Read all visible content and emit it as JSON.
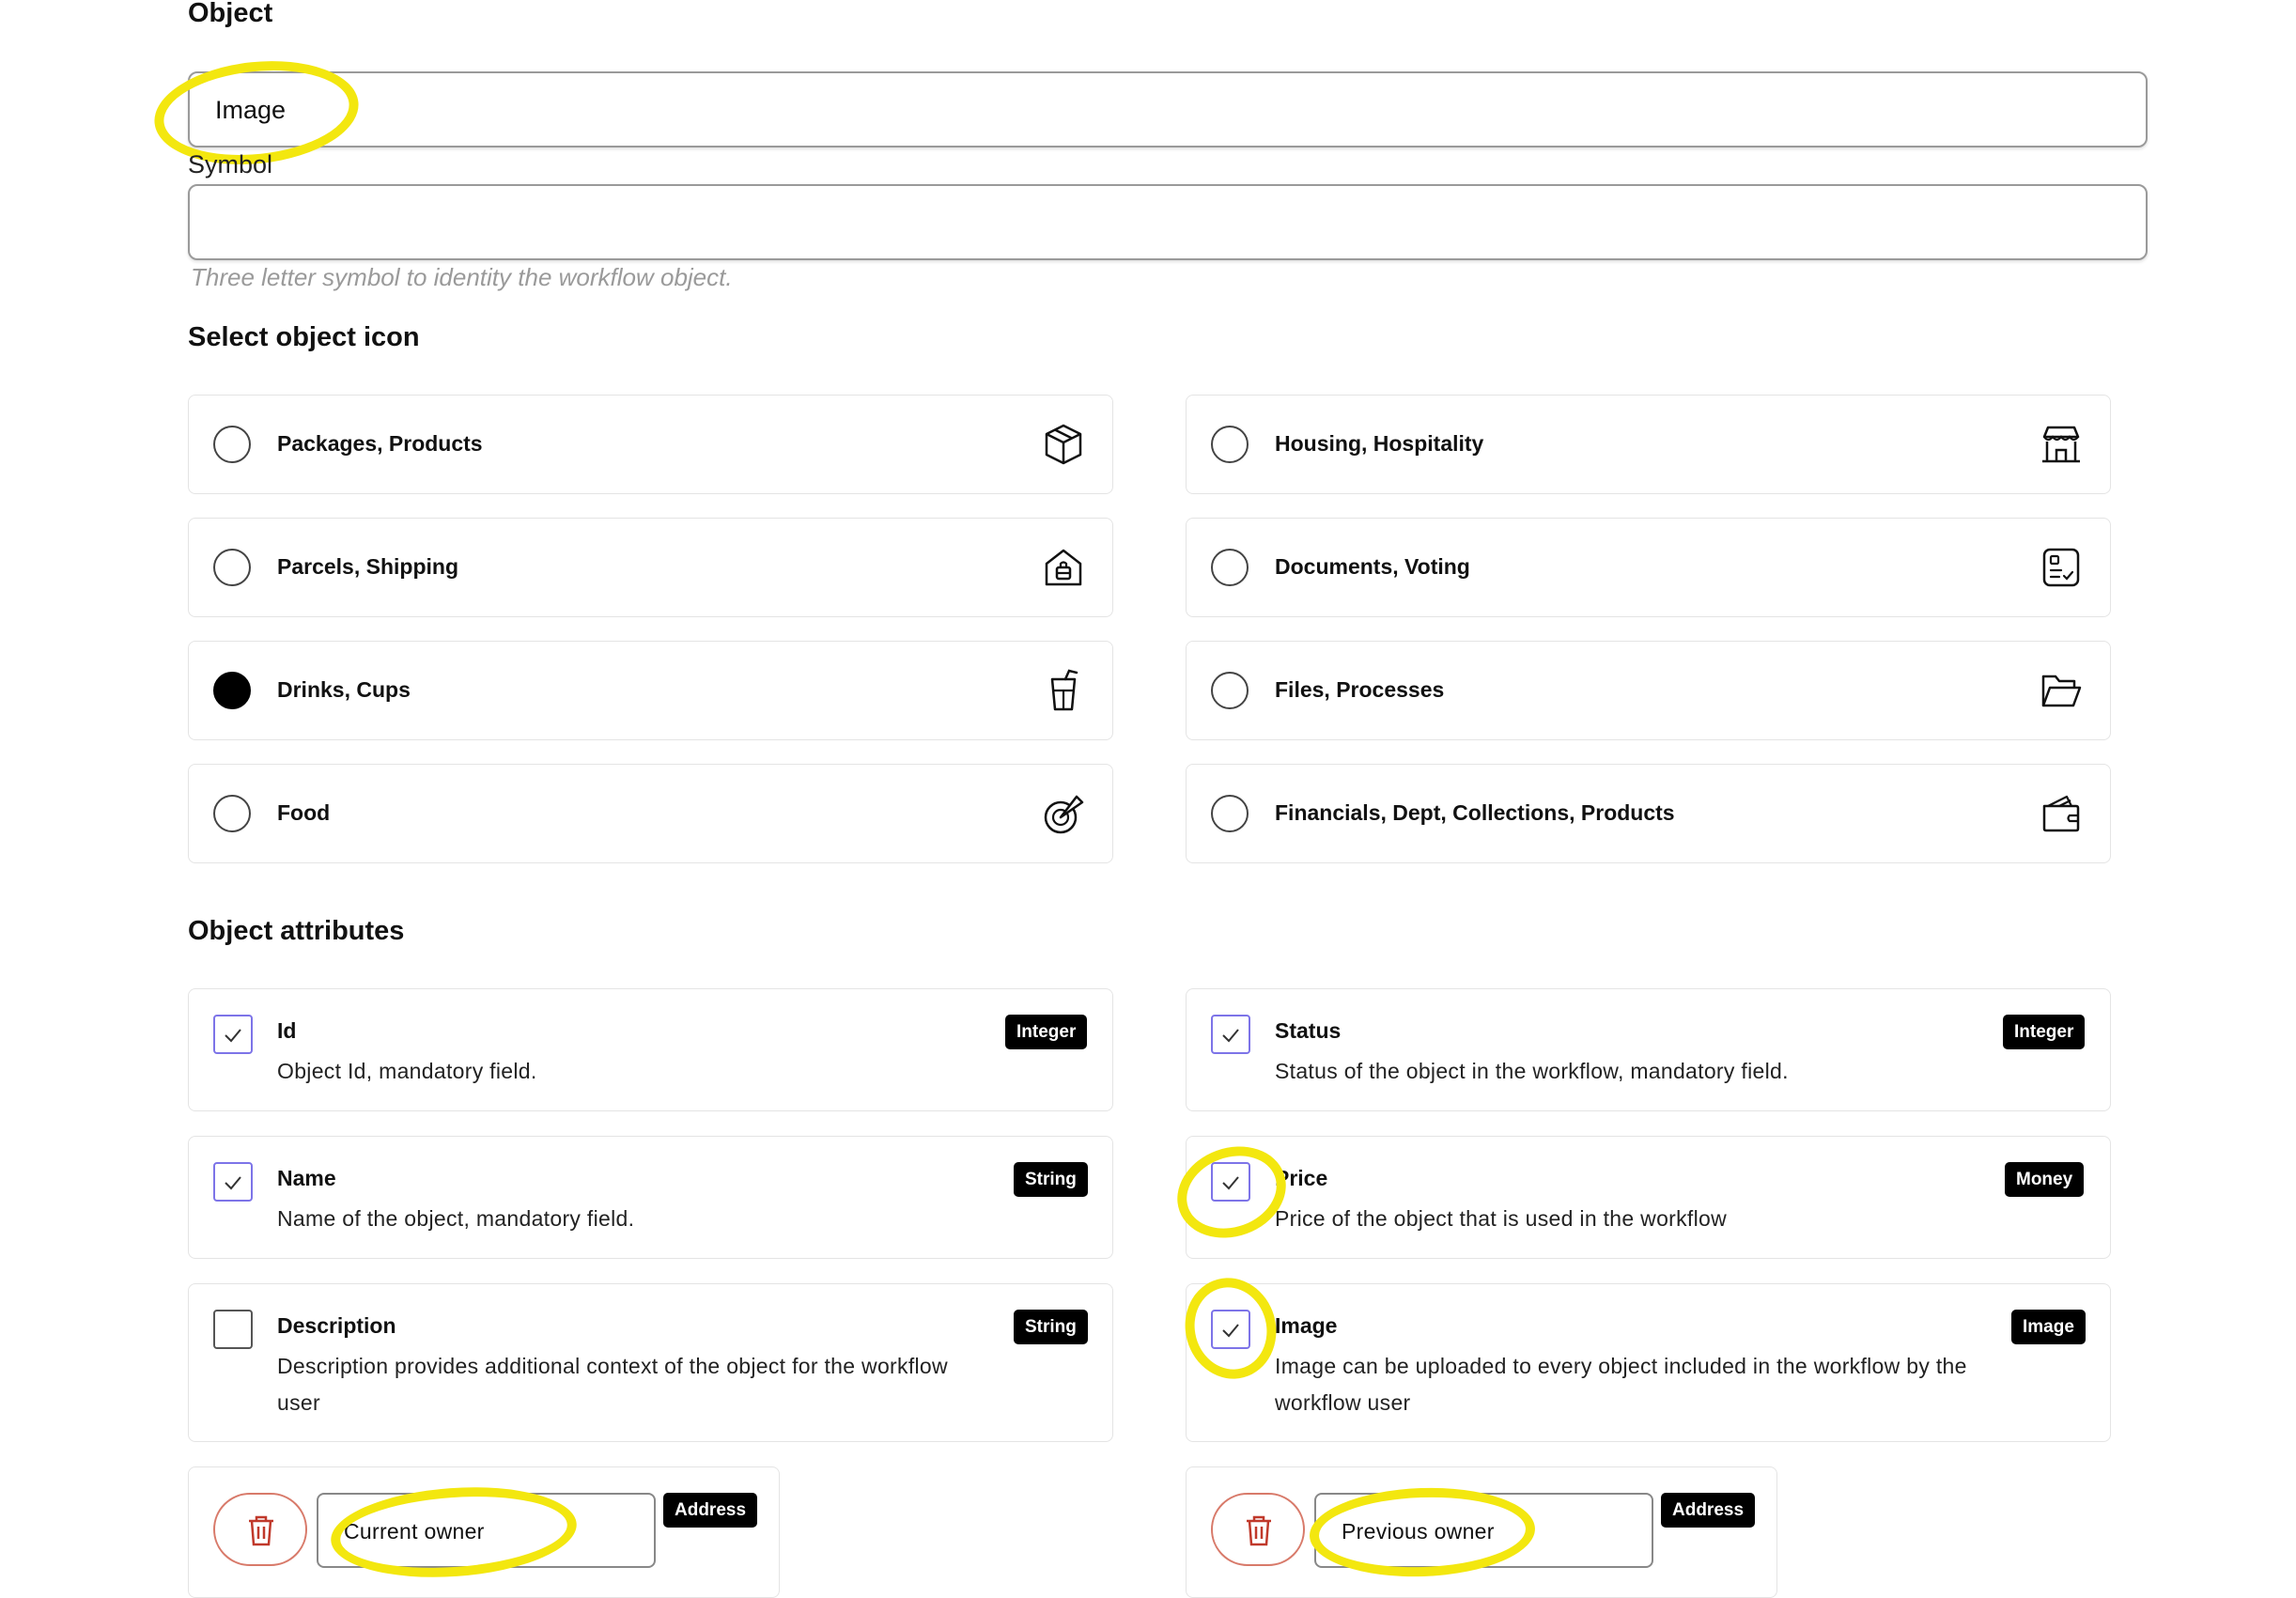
{
  "form": {
    "object_label": "Object",
    "object_value": "Image",
    "symbol_label": "Symbol",
    "symbol_value": "",
    "symbol_hint": "Three letter symbol to identity the workflow object."
  },
  "icon_section": {
    "title": "Select object icon",
    "options": [
      {
        "label": "Packages, Products",
        "icon": "package-icon",
        "selected": false
      },
      {
        "label": "Housing, Hospitality",
        "icon": "storefront-icon",
        "selected": false
      },
      {
        "label": "Parcels, Shipping",
        "icon": "parcel-icon",
        "selected": false
      },
      {
        "label": "Documents, Voting",
        "icon": "document-checklist-icon",
        "selected": false
      },
      {
        "label": "Drinks, Cups",
        "icon": "drink-cup-icon",
        "selected": true
      },
      {
        "label": "Files, Processes",
        "icon": "folder-open-icon",
        "selected": false
      },
      {
        "label": "Food",
        "icon": "food-icon",
        "selected": false
      },
      {
        "label": "Financials, Dept, Collections, Products",
        "icon": "wallet-icon",
        "selected": false
      }
    ]
  },
  "attributes_section": {
    "title": "Object attributes",
    "attributes": [
      {
        "name": "Id",
        "description": "Object Id, mandatory field.",
        "type": "Integer",
        "checked": true
      },
      {
        "name": "Status",
        "description": "Status of the object in the workflow, mandatory field.",
        "type": "Integer",
        "checked": true
      },
      {
        "name": "Name",
        "description": "Name of the object, mandatory field.",
        "type": "String",
        "checked": true
      },
      {
        "name": "Price",
        "description": "Price of the object that is used in the workflow",
        "type": "Money",
        "checked": true
      },
      {
        "name": "Description",
        "description_line1": "Description provides additional context of the object for the workflow",
        "description_line2": "user",
        "type": "String",
        "checked": false
      },
      {
        "name": "Image",
        "description_line1": "Image can be uploaded to every object included in the workflow by the",
        "description_line2": "workflow user",
        "type": "Image",
        "checked": true
      }
    ],
    "custom": [
      {
        "value": "Current owner",
        "type": "Address"
      },
      {
        "value": "Previous owner",
        "type": "Address"
      }
    ]
  },
  "colors": {
    "highlight": "#f3e70f",
    "checkbox_border": "#7d74e8",
    "badge_bg": "#000000",
    "delete_border": "#d87a6a",
    "delete_icon": "#c0392b"
  }
}
